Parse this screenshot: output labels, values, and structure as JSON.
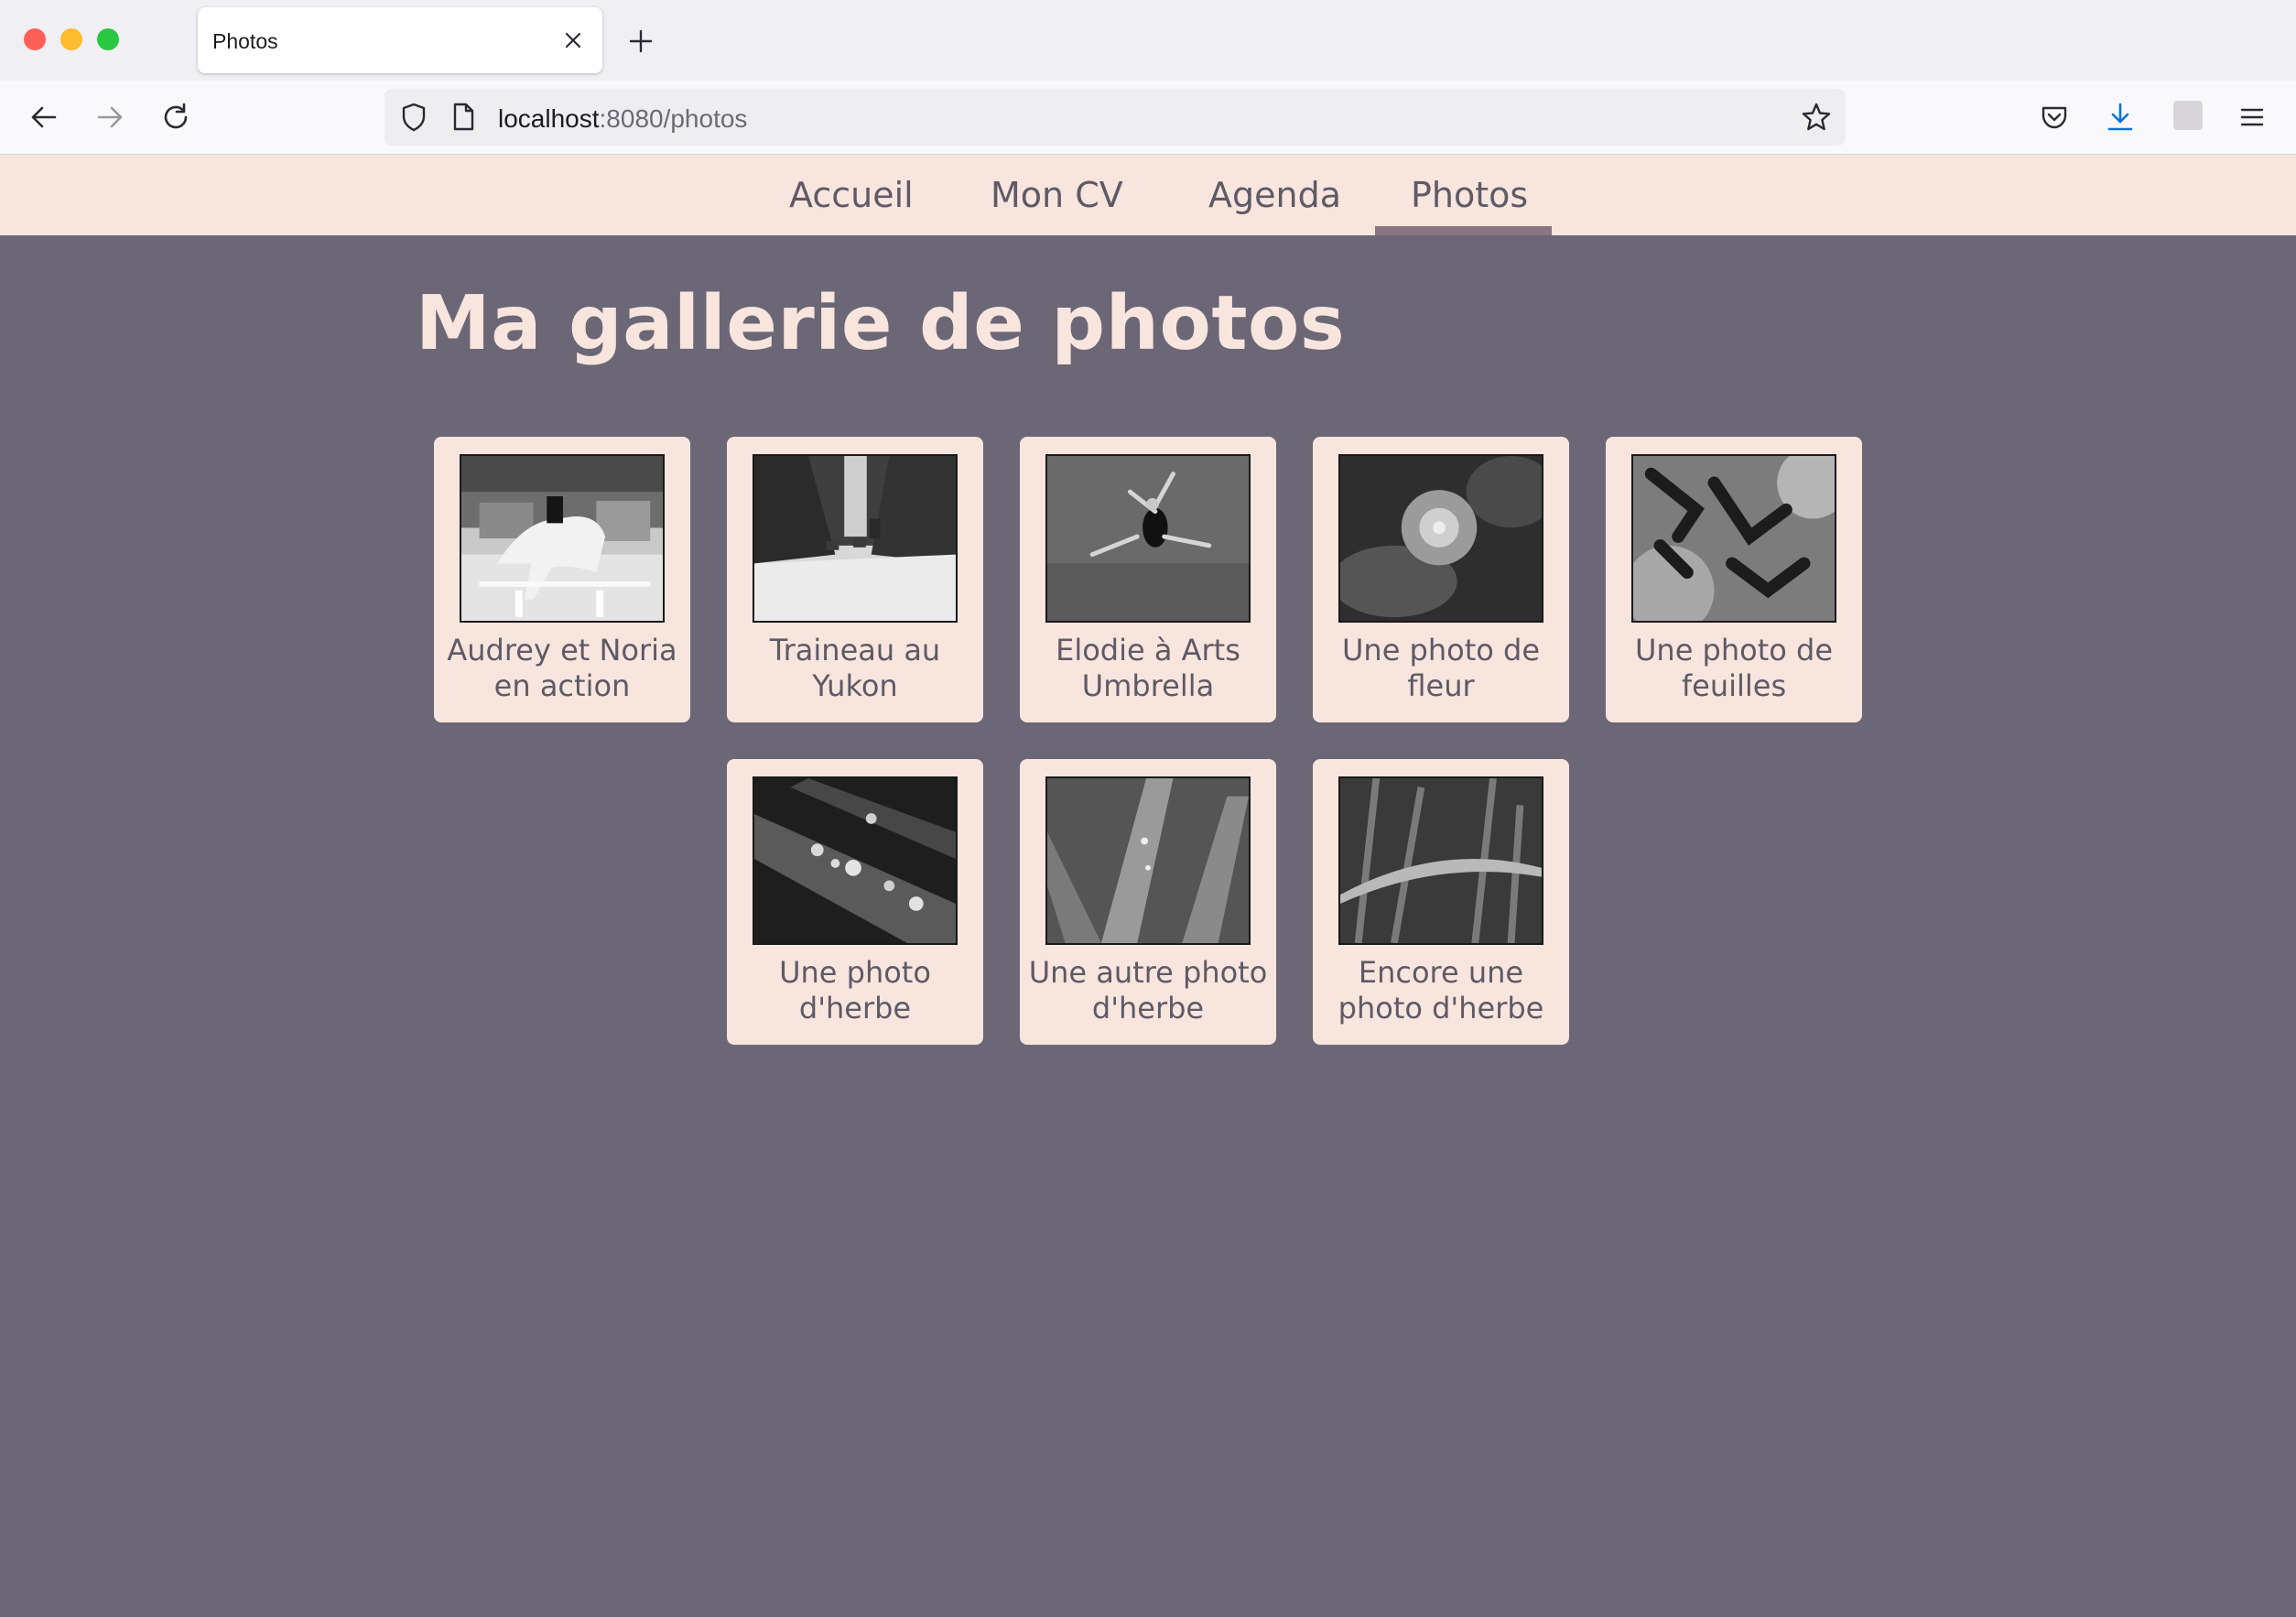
{
  "browser": {
    "tab_title": "Photos",
    "url_host": "localhost",
    "url_rest": ":8080/photos"
  },
  "icons": {
    "tab_close": "close-icon",
    "new_tab": "plus-icon",
    "back": "arrow-left-icon",
    "forward": "arrow-right-icon",
    "reload": "reload-icon",
    "shield": "shield-icon",
    "page": "page-icon",
    "bookmark": "star-icon",
    "pocket": "pocket-icon",
    "downloads": "download-icon",
    "extension": "extension-icon",
    "menu": "hamburger-menu-icon"
  },
  "colors": {
    "page_background": "#6c6776",
    "nav_background": "#f8e5de",
    "active_underline": "#8a7480",
    "text": "#5e5a66"
  },
  "nav": {
    "items": [
      {
        "label": "Accueil",
        "active": false
      },
      {
        "label": "Mon CV",
        "active": false
      },
      {
        "label": "Agenda",
        "active": false
      },
      {
        "label": "Photos",
        "active": true
      }
    ]
  },
  "page": {
    "title": "Ma gallerie de photos"
  },
  "gallery": {
    "photos": [
      {
        "caption": "Audrey et Noria en action"
      },
      {
        "caption": "Traineau au Yukon"
      },
      {
        "caption": "Elodie à Arts Umbrella"
      },
      {
        "caption": "Une photo de fleur"
      },
      {
        "caption": "Une photo de feuilles"
      },
      {
        "caption": "Une photo d'herbe"
      },
      {
        "caption": "Une autre photo d'herbe"
      },
      {
        "caption": "Encore une photo d'herbe"
      }
    ]
  }
}
